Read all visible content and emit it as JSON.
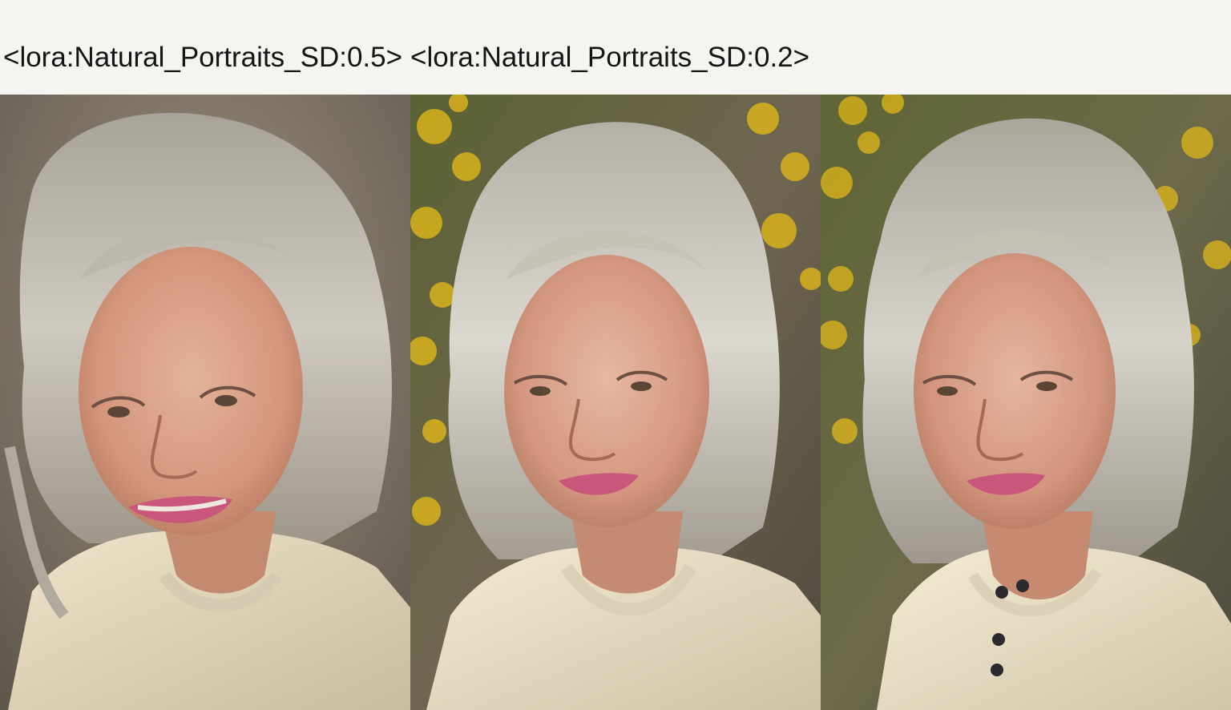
{
  "header": {
    "labels": [
      "<lora:Natural_Portraits_SD:0.5>",
      "<lora:Natural_Portraits_SD:0.2>"
    ]
  },
  "images": [
    {
      "subject": "portrait-smiling-gray-haired-woman",
      "background": "plain-warm-gray"
    },
    {
      "subject": "portrait-smiling-gray-haired-woman",
      "background": "yellow-flowers-bokeh"
    },
    {
      "subject": "portrait-smiling-gray-haired-woman",
      "background": "yellow-flowers-bokeh",
      "detail": "buttoned-sweater"
    }
  ],
  "colors": {
    "page_bg": "#f5f4f0",
    "text": "#141414",
    "hair": "#b9b5aa",
    "skin": "#d8a187",
    "sweater": "#e6dcc0",
    "flowers": "#d9b21c",
    "foliage": "#4f5a30"
  }
}
